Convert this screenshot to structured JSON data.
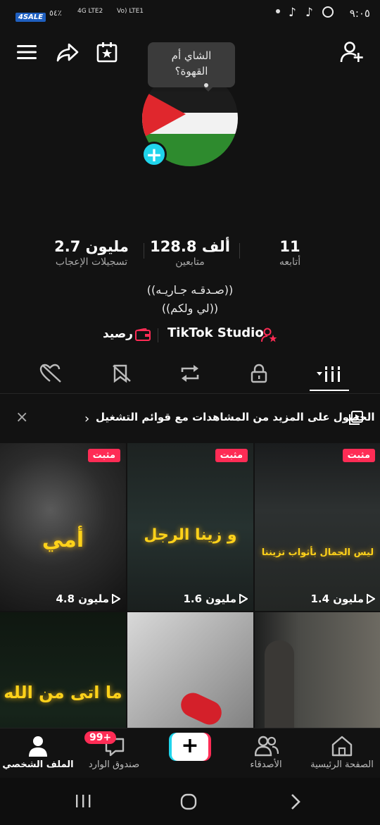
{
  "status": {
    "time": "٩:٠٥",
    "left_text": "٥٤٪",
    "brand": "4SALE",
    "network_labels": [
      "4G LTE2",
      "Vo) LTE1"
    ],
    "app_icons": [
      "tiktok-icon",
      "tiktok-icon",
      "whatsapp-icon"
    ]
  },
  "tooltip": {
    "line1": "الشاي أم",
    "line2": "القهوة؟"
  },
  "stats": {
    "likes_value": "2.7 مليون",
    "likes_label": "تسجيلات الإعجاب",
    "followers_value": "128.8 ألف",
    "followers_label": "متابعين",
    "following_value": "11",
    "following_label": "أتابعه"
  },
  "bio": {
    "line1": "((صـدقـه جـاريـه))",
    "line2": "((لي ولكم))"
  },
  "links": {
    "balance": "رصيد",
    "studio": "TikTok Studio"
  },
  "tabs": [
    "videos-grid",
    "private-lock",
    "reposts",
    "favorites",
    "liked-hidden"
  ],
  "banner": {
    "text": "الحصول على المزيد من المشاهدات مع قوائم التشغيل",
    "chevron": "›"
  },
  "videos": [
    {
      "pinned": "مثبت",
      "views": "4.8 مليون",
      "title": "أمي"
    },
    {
      "pinned": "مثبت",
      "views": "1.6 مليون",
      "title": "و زينا الرجل"
    },
    {
      "pinned": "مثبت",
      "views": "1.4 مليون",
      "title": "ليس الجمال بأثواب تزيننا"
    },
    {
      "title": "ما اتى من الله"
    },
    {},
    {}
  ],
  "bottom_nav": {
    "profile": "الملف الشخصي",
    "inbox": "صندوق الوارد",
    "inbox_badge": "99+",
    "friends": "الأصدقاء",
    "home": "الصفحة الرئيسية"
  },
  "colors": {
    "accent": "#fe2c55",
    "cyan": "#20d5ec",
    "background": "#121212"
  }
}
